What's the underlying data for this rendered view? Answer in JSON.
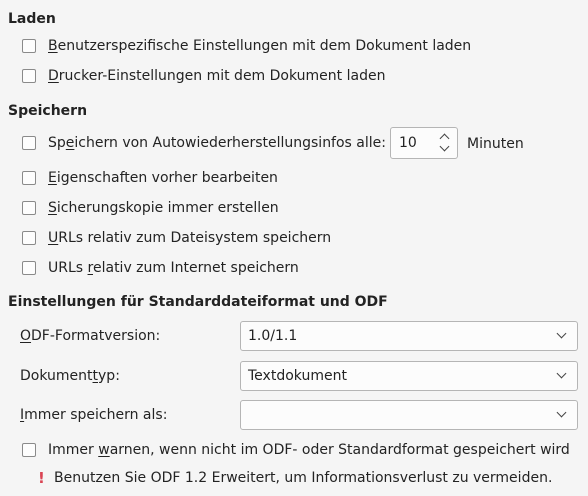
{
  "laden": {
    "title": "Laden",
    "items": [
      {
        "accel": "B",
        "rest": "enutzerspezifische Einstellungen mit dem Dokument laden"
      },
      {
        "accel": "D",
        "rest": "rucker-Einstellungen mit dem Dokument laden"
      }
    ]
  },
  "speichern": {
    "title": "Speichern",
    "autosave": {
      "pre": "Sp",
      "accel": "e",
      "rest": "ichern von Autowiederherstellungsinfos alle:",
      "value": "10",
      "unit": "Minuten"
    },
    "items": [
      {
        "pre": "",
        "accel": "E",
        "rest": "igenschaften vorher bearbeiten"
      },
      {
        "pre": "",
        "accel": "S",
        "rest": "icherungskopie immer erstellen"
      },
      {
        "pre": "",
        "accel": "U",
        "rest": "RLs relativ zum Dateisystem speichern"
      },
      {
        "pre": "URLs ",
        "accel": "r",
        "rest": "elativ zum Internet speichern"
      }
    ]
  },
  "format": {
    "title": "Einstellungen für Standarddateiformat und ODF",
    "odf_label": {
      "accel": "O",
      "rest": "DF-Formatversion:"
    },
    "odf_value": "1.0/1.1",
    "doctype_label": {
      "pre": "Dokument",
      "accel": "t",
      "rest": "yp:"
    },
    "doctype_value": "Textdokument",
    "saveas_label": {
      "accel": "I",
      "rest": "mmer speichern als:"
    },
    "saveas_value": "",
    "warn_checkbox": {
      "pre": "Immer ",
      "accel": "w",
      "rest": "arnen, wenn nicht im ODF- oder Standardformat gespeichert wird"
    },
    "warning_icon": "!",
    "warning_text": "Benutzen Sie ODF 1.2 Erweitert, um Informationsverlust zu vermeiden."
  }
}
